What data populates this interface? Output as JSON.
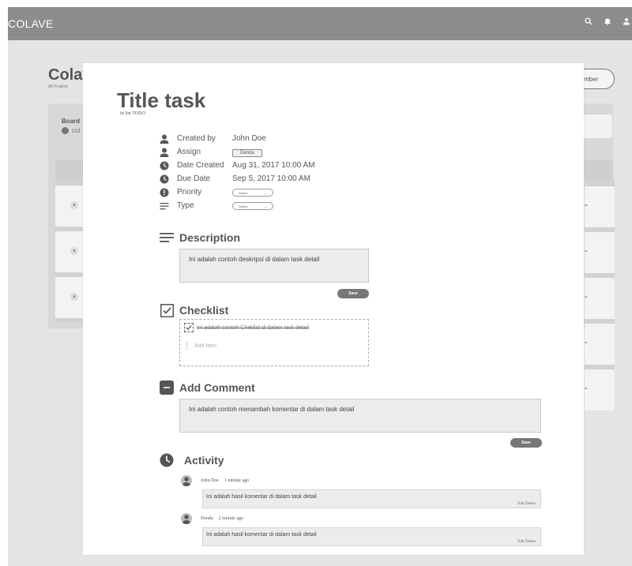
{
  "app": {
    "brand": "COLAVE"
  },
  "background": {
    "project_title": "Colav",
    "project_subtitle": "All Projects",
    "member_button": "mber",
    "board_label": "Board",
    "board_sub": "col",
    "card_avatar_label": "a",
    "right_card_label": "="
  },
  "modal": {
    "title": "Title task",
    "list_info": "In list TODO",
    "meta": {
      "created_by_label": "Created by",
      "created_by_value": "John Doe",
      "assign_label": "Assign",
      "assign_value": "Denda",
      "date_created_label": "Date Created",
      "date_created_value": "Aug 31, 2017 10:00 AM",
      "due_date_label": "Due Date",
      "due_date_value": "Sep 5, 2017 10:00 AM",
      "priority_label": "Priority",
      "priority_select": "Select",
      "type_label": "Type",
      "type_select": "Select"
    },
    "description": {
      "heading": "Description",
      "text": "Ini adalah contoh deskripsi di dalam task detail",
      "save_label": "Save"
    },
    "checklist": {
      "heading": "Checklist",
      "item": "Ini adalah contoh Cheklist di dalam task detail",
      "add_placeholder": "Add Item"
    },
    "comment": {
      "heading": "Add Comment",
      "text": "Ini adalah contoh menambah komentar di dalam task detail",
      "save_label": "Save"
    },
    "activity": {
      "heading": "Activity",
      "entries": [
        {
          "user": "John Doe",
          "time": "1 minute ago",
          "text": "Ini adalah hasil komentar di dalam task detail",
          "actions": "Edit Delete"
        },
        {
          "user": "Denda",
          "time": "2 minute ago",
          "text": "Ini adalah hasil komentar di dalam task detail",
          "actions": "Edit Delete"
        }
      ]
    }
  },
  "colors": {
    "topbar": "#8a8a8a",
    "overlay": "#e6e6e6",
    "button": "#777777",
    "textbox": "#ececec"
  }
}
